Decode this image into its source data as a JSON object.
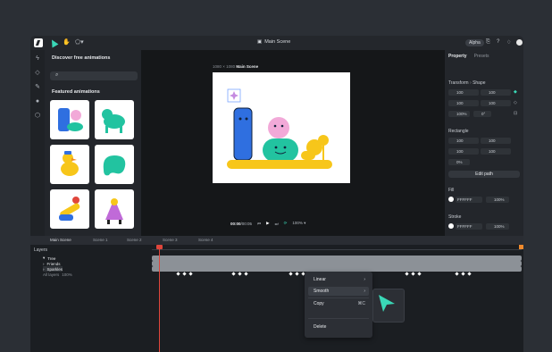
{
  "app": {
    "title": "Main Scene",
    "badge": "Alpha"
  },
  "left_panel": {
    "title": "Discover free animations",
    "search_placeholder": "",
    "featured_title": "Featured animations"
  },
  "canvas": {
    "artboard_size": "1080 × 1080",
    "artboard_name": "Main Scene",
    "time": "00:00",
    "duration": "/00:05",
    "zoom": "100%"
  },
  "right_panel": {
    "tabs": [
      "Property",
      "Presets"
    ],
    "transform_title": "Transform",
    "transform_sub": "Shape",
    "transform_fields": [
      "100",
      "100",
      "100",
      "100",
      "100%",
      "0°"
    ],
    "rectangle_title": "Rectangle",
    "rectangle_fields": [
      "100",
      "100",
      "100",
      "100",
      "0%"
    ],
    "edit_path": "Edit path",
    "fill_title": "Fill",
    "fill_color": "FFFFFF",
    "fill_opacity": "100%",
    "stroke_title": "Stroke",
    "stroke_color": "FFFFFF",
    "stroke_opacity": "100%"
  },
  "scenes": [
    "Main Scene",
    "Scene 1",
    "Scene 2",
    "Scene 3",
    "Scene 4"
  ],
  "layers": {
    "header": "Layers",
    "rows": [
      "Tree",
      "Friends",
      "Sparkles",
      "All layers"
    ],
    "sparkles_opacity": "100%"
  },
  "context_menu": {
    "items": [
      "Linear",
      "Smooth",
      "Copy",
      "Delete"
    ],
    "copy_shortcut": "⌘C"
  },
  "colors": {
    "accent": "#3ad8b7",
    "playhead": "#e0463c",
    "blue": "#2f6fe0",
    "pink": "#f2a9d8",
    "teal": "#22c3a0",
    "yellow": "#f7c61a"
  }
}
